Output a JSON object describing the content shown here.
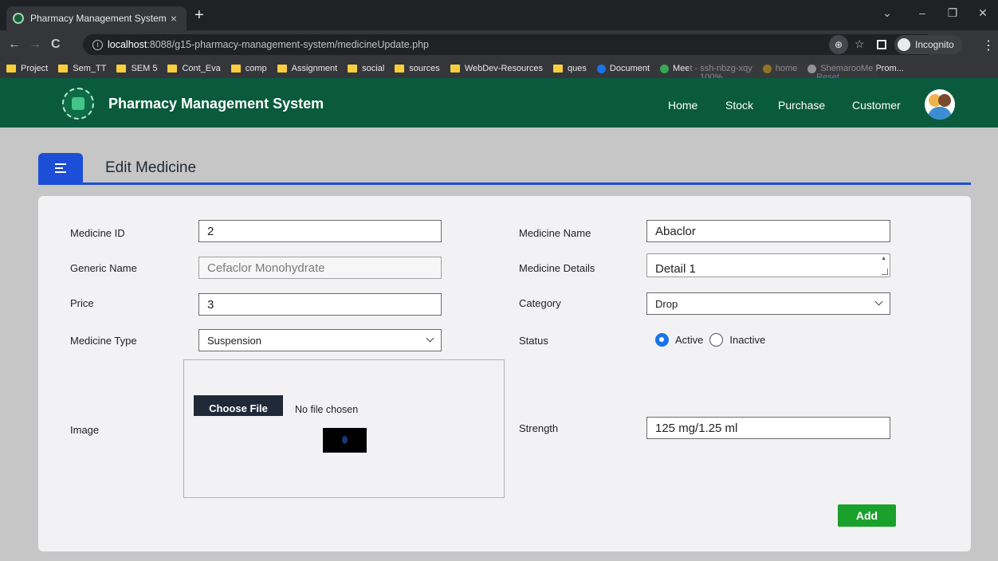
{
  "browser": {
    "tab_title": "Pharmacy Management System",
    "tab_close": "×",
    "new_tab": "+",
    "url_host": "localhost",
    "url_rest": ":8088/g15-pharmacy-management-system/medicineUpdate.php",
    "incognito_label": "Incognito",
    "bookmarks": [
      {
        "label": "Project",
        "icon": "folder"
      },
      {
        "label": "Sem_TT",
        "icon": "folder"
      },
      {
        "label": "SEM 5",
        "icon": "folder"
      },
      {
        "label": "Cont_Eva",
        "icon": "folder"
      },
      {
        "label": "comp",
        "icon": "folder"
      },
      {
        "label": "Assignment",
        "icon": "folder"
      },
      {
        "label": "social",
        "icon": "folder"
      },
      {
        "label": "sources",
        "icon": "folder"
      },
      {
        "label": "WebDev-Resources",
        "icon": "folder"
      },
      {
        "label": "ques",
        "icon": "folder"
      },
      {
        "label": "Document",
        "icon": "circle",
        "color": "#1a73e8"
      },
      {
        "label": "Meet - ssh-nbzg-xqy",
        "icon": "circle",
        "color": "#34a853"
      },
      {
        "label": "home",
        "icon": "circle",
        "color": "#fbbc04"
      },
      {
        "label": "ShemarooMe Prom...",
        "icon": "circle",
        "color": "#ffffff"
      }
    ],
    "zoom_popup": {
      "percent": "100%",
      "reset": "Reset"
    }
  },
  "navbar": {
    "brand": "Pharmacy Management System",
    "links": [
      "Home",
      "Stock",
      "Purchase",
      "Customer"
    ]
  },
  "section": {
    "title": "Edit Medicine"
  },
  "form": {
    "medicine_id": {
      "label": "Medicine ID",
      "value": "2"
    },
    "medicine_name": {
      "label": "Medicine Name",
      "value": "Abaclor"
    },
    "generic_name": {
      "label": "Generic Name",
      "value": "Cefaclor Monohydrate"
    },
    "medicine_details": {
      "label": "Medicine Details",
      "value": "Detail 1"
    },
    "price": {
      "label": "Price",
      "value": "3"
    },
    "category": {
      "label": "Category",
      "value": "Drop"
    },
    "medicine_type": {
      "label": "Medicine Type",
      "value": "Suspension"
    },
    "status": {
      "label": "Status",
      "options": [
        "Active",
        "Inactive"
      ],
      "selected": "Active"
    },
    "image": {
      "label": "Image",
      "button": "Choose File",
      "status": "No file chosen"
    },
    "strength": {
      "label": "Strength",
      "value": "125 mg/1.25 ml"
    },
    "submit_label": "Add"
  },
  "colors": {
    "navbar": "#0a5a3e",
    "accent": "#1d4ed8",
    "submit": "#1aa12c"
  }
}
